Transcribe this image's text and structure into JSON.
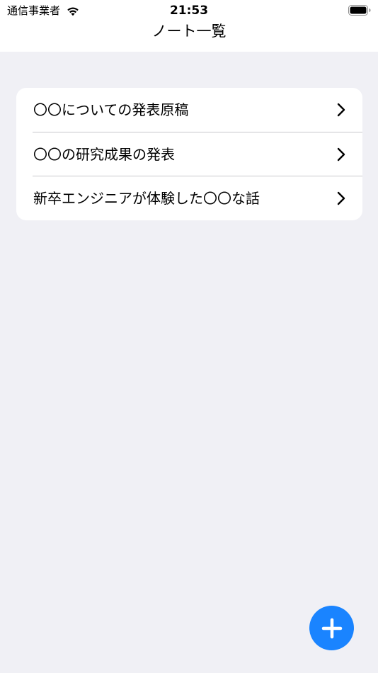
{
  "status_bar": {
    "carrier": "通信事業者",
    "time": "21:53"
  },
  "nav": {
    "title": "ノート一覧"
  },
  "notes": [
    {
      "title": "〇〇についての発表原稿"
    },
    {
      "title": "〇〇の研究成果の発表"
    },
    {
      "title": "新卒エンジニアが体験した〇〇な話"
    }
  ],
  "fab": {
    "icon": "plus-icon",
    "color": "#1a84ff"
  },
  "colors": {
    "background": "#f0f0f5",
    "card": "#ffffff",
    "accent": "#1a84ff"
  }
}
